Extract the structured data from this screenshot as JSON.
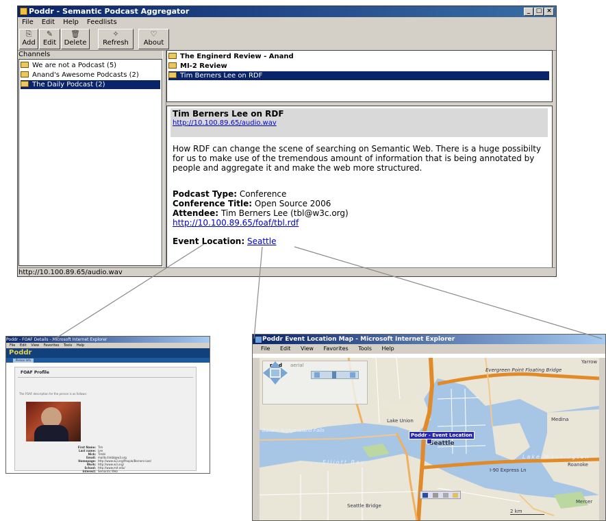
{
  "main_window": {
    "title": "Poddr - Semantic Podcast Aggregator",
    "window_controls": [
      "_",
      "□",
      "×"
    ]
  },
  "menu": [
    "File",
    "Edit",
    "Help",
    "Feedlists"
  ],
  "toolbar": [
    {
      "label": "Add",
      "icon": "add-icon"
    },
    {
      "label": "Edit",
      "icon": "edit-icon"
    },
    {
      "label": "Delete",
      "icon": "trash-icon"
    },
    {
      "label": "Refresh",
      "icon": "refresh-icon"
    },
    {
      "label": "About",
      "icon": "speech-bubble-icon"
    }
  ],
  "channels": {
    "label": "Channels",
    "items": [
      {
        "label": "We are not a Podcast (5)",
        "selected": false
      },
      {
        "label": "Anand's Awesome Podcasts (2)",
        "selected": false
      },
      {
        "label": "The Daily Podcast (2)",
        "selected": true
      }
    ]
  },
  "episodes": [
    {
      "label": "The Enginerd Review - Anand",
      "bold": true,
      "selected": false
    },
    {
      "label": "MI-2 Review",
      "bold": true,
      "selected": false
    },
    {
      "label": "Tim Berners Lee on RDF",
      "bold": false,
      "selected": true
    }
  ],
  "detail": {
    "title": "Tim Berners Lee on RDF",
    "audio_link": "http://10.100.89.65/audio.wav",
    "description": "How RDF can change the scene of searching on Semantic Web. There is a huge possibilty for us to make use of the tremendous amount of information that is being annotated by people and aggregate it and make the web more structured.",
    "podcast_type_label": "Podcast Type:",
    "podcast_type": "Conference",
    "conference_title_label": "Conference Title:",
    "conference_title": "Open Source 2006",
    "attendee_label": "Attendee:",
    "attendee": "Tim Berners Lee (tbl@w3c.org)",
    "foaf_link": "http://10.100.89.65/foaf/tbl.rdf",
    "event_location_label": "Event Location:",
    "event_location": "Seattle"
  },
  "status_bar": "http://10.100.89.65/audio.wav",
  "foaf_window": {
    "title": "Poddr - FOAF Details - Microsoft Internet Explorer",
    "menu": [
      "File",
      "Edit",
      "View",
      "Favorites",
      "Tools",
      "Help"
    ],
    "banner": "Poddr",
    "tab": "Person Info",
    "heading": "FOAF Profile",
    "intro": "The FOAF description for the person is as follows:",
    "fields": [
      {
        "key": "First Name:",
        "value": "Tim"
      },
      {
        "key": "Last name:",
        "value": "Lee"
      },
      {
        "key": "Nick:",
        "value": "Timbl"
      },
      {
        "key": "Email:",
        "value": "mailto:timbl@w3.org"
      },
      {
        "key": "Homepage:",
        "value": "http://www.w3.org/People/Berners-Lee/"
      },
      {
        "key": "Work:",
        "value": "http://www.w3.org/"
      },
      {
        "key": "School:",
        "value": "http://www.mit.edu/"
      },
      {
        "key": "Interest:",
        "value": "Semantic Web"
      }
    ]
  },
  "map_window": {
    "title": "Poddr Event Location Map - Microsoft Internet Explorer",
    "menu": [
      "File",
      "Edit",
      "View",
      "Favorites",
      "Tools",
      "Help"
    ],
    "tabs": [
      "road",
      "aerial"
    ],
    "pin_label": "Poddr - Event Location",
    "place_labels": {
      "lake_union": "Lake Union",
      "elliott_bay": "Elliott Bay",
      "lake_washington": "Lake Washington",
      "medina": "Medina",
      "evergreen": "Evergreen Point Floating Bridge",
      "seattle_bridge": "Seattle Bridge",
      "express": "I-90 Express Ln",
      "roanoke": "Roanoke",
      "yarrow": "Yarrow",
      "mercer": "Mercer",
      "seattle": "Seattle",
      "ship_canal": "Ballard Bridge Island Falls",
      "scale": "2 km"
    }
  }
}
